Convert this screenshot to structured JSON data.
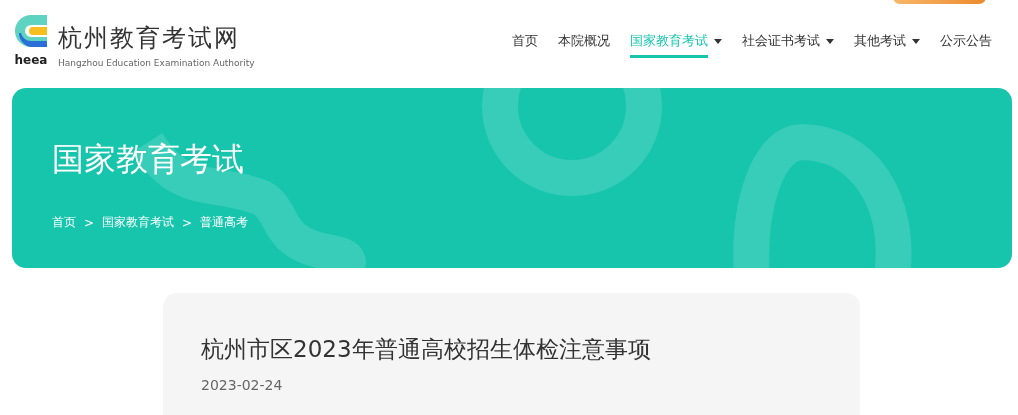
{
  "logo": {
    "mark_text": "heea",
    "title": "杭州教育考试网",
    "subtitle": "Hangzhou Education Examination Authority"
  },
  "nav": [
    {
      "label": "首页",
      "selected": false,
      "dropdown": false
    },
    {
      "label": "本院概况",
      "selected": false,
      "dropdown": false
    },
    {
      "label": "国家教育考试",
      "selected": true,
      "dropdown": true
    },
    {
      "label": "社会证书考试",
      "selected": false,
      "dropdown": true
    },
    {
      "label": "其他考试",
      "selected": false,
      "dropdown": true
    },
    {
      "label": "公示公告",
      "selected": false,
      "dropdown": false
    }
  ],
  "banner": {
    "title": "国家教育考试",
    "breadcrumb": [
      {
        "label": "首页"
      },
      {
        "label": "国家教育考试"
      },
      {
        "label": "普通高考"
      }
    ],
    "separator": ">"
  },
  "article": {
    "title": "杭州市区2023年普通高校招生体检注意事项",
    "date": "2023-02-24"
  }
}
